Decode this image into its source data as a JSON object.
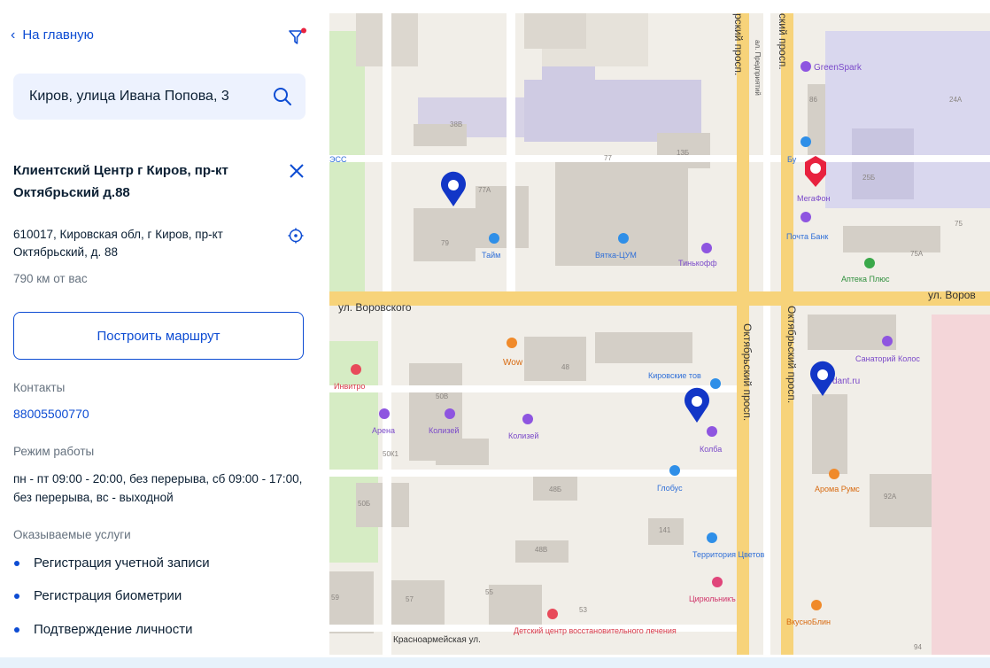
{
  "nav": {
    "back_label": "На главную",
    "back_chevron": "‹"
  },
  "search": {
    "value": "Киров, улица Ивана Попова, 3"
  },
  "office": {
    "title": "Клиентский Центр г Киров, пр-кт Октябрьский д.88",
    "address": "610017, Кировская обл, г Киров, пр-кт Октябрьский, д. 88",
    "distance": "790 км от вас"
  },
  "route_button": "Построить маршрут",
  "contacts": {
    "label": "Контакты",
    "phone": "88005500770"
  },
  "hours": {
    "label": "Режим работы",
    "text": "пн - пт 09:00 - 20:00, без перерыва, сб 09:00 - 17:00, без перерыва, вс - выходной"
  },
  "services": {
    "label": "Оказываемые услуги",
    "items": [
      "Регистрация учетной записи",
      "Регистрация биометрии",
      "Подтверждение личности"
    ]
  },
  "colors": {
    "accent": "#0d4cd3",
    "marker_blue": "#1236c7",
    "marker_red": "#e8223f"
  },
  "map": {
    "streets": {
      "vorovskogo_left": "ул. Воровского",
      "vorovskogo_right": "ул. Воров",
      "oktyabrsky_1": "Октябрьский просп.",
      "oktyabrsky_2": "Октябрьский просп.",
      "oktyabrsky_top1": "рский просп.",
      "oktyabrsky_top2": "ский просп.",
      "predpriyatiy": "ал. Предприятий",
      "krasnoarm": "Красноармейская ул."
    },
    "houses": [
      "38В",
      "77А",
      "77",
      "13Б",
      "79",
      "50В",
      "48",
      "48Б",
      "48В",
      "141",
      "50Б",
      "59",
      "57",
      "55",
      "53",
      "86",
      "25Б",
      "24А",
      "75А",
      "75",
      "92А",
      "50К1",
      "94"
    ],
    "pois": [
      "GreenSpark",
      "МегаФон",
      "Почта Банк",
      "Аптека Плюс",
      "Тинькофф",
      "Вятка-ЦУМ",
      "Тайм",
      "Wow",
      "Инвитро",
      "Арена",
      "Колизей",
      "Колизей",
      "Кировские тов",
      "Колба",
      "Глобус",
      "Территория Цветов",
      "Санаторий Колос",
      "dant.ru",
      "Арома Румс",
      "Цирюльникъ",
      "ВкусноБлин",
      "Детский центр восстановительного лечения",
      "ЭСС",
      "Бу"
    ]
  }
}
